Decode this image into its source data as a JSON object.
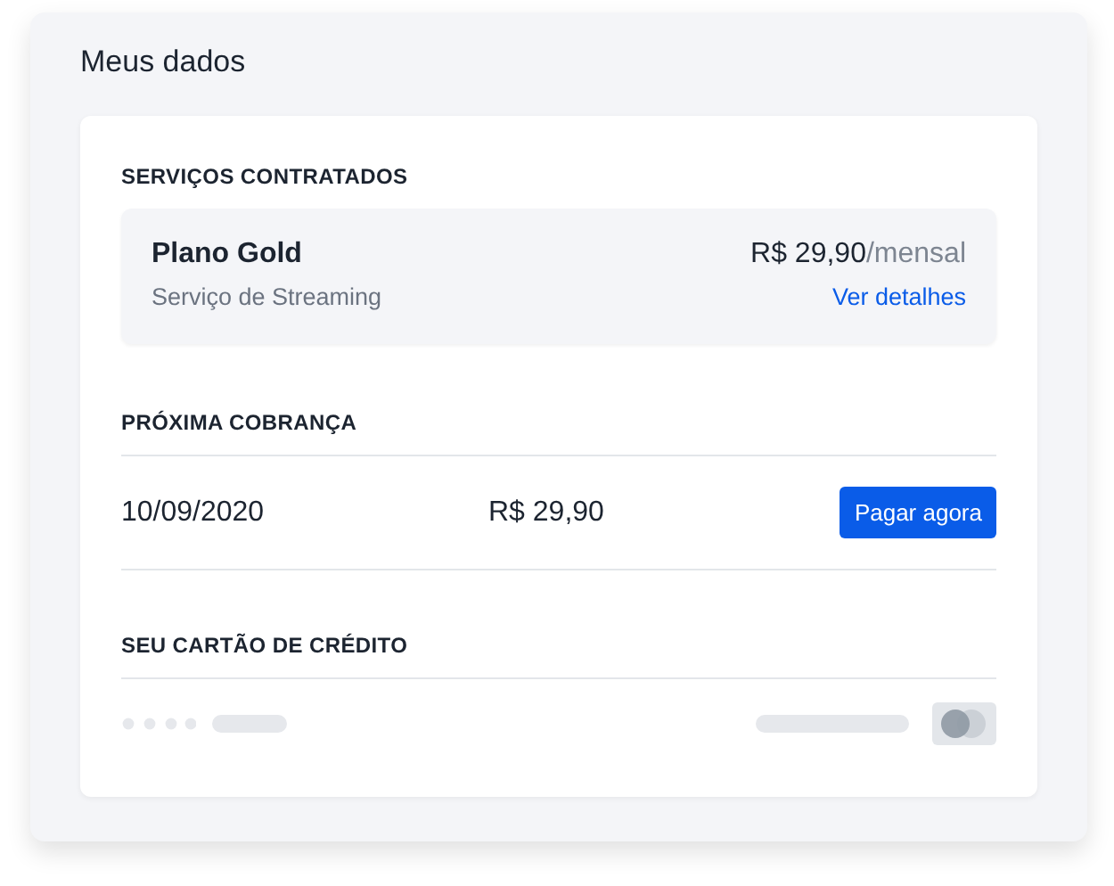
{
  "panel": {
    "title": "Meus dados"
  },
  "services": {
    "heading": "SERVIÇOS CONTRATADOS",
    "plan": "Plano Gold",
    "description": "Serviço de Streaming",
    "price": "R$ 29,90",
    "period": "/mensal",
    "link": "Ver detalhes"
  },
  "next_charge": {
    "heading": "PRÓXIMA COBRANÇA",
    "date": "10/09/2020",
    "amount": "R$ 29,90",
    "button": "Pagar agora"
  },
  "credit_card": {
    "heading": "SEU CARTÃO DE CRÉDITO"
  }
}
